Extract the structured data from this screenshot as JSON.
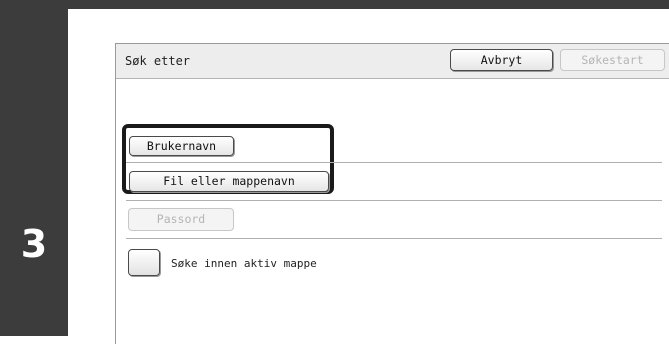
{
  "step": {
    "number": "3"
  },
  "header": {
    "title": "Søk etter",
    "cancel_label": "Avbryt",
    "search_start_label": "Søkestart"
  },
  "options": {
    "username_label": "Brukernavn",
    "file_folder_label": "Fil eller mappenavn",
    "password_label": "Passord"
  },
  "checkbox": {
    "label": "Søke innen aktiv mappe",
    "checked": false
  },
  "colors": {
    "dark_frame": "#3c3c3c",
    "header_bg": "#ededed",
    "disabled_text": "#b5b5b5"
  }
}
